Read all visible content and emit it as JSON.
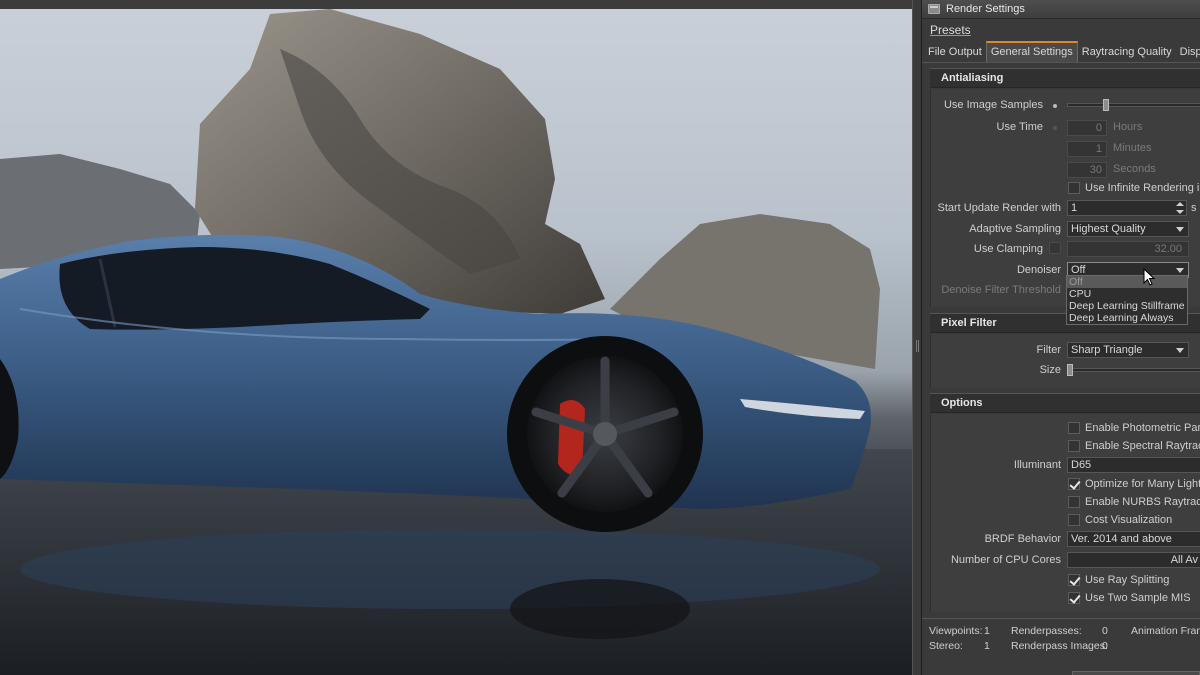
{
  "window": {
    "title": "Render Settings"
  },
  "menu": {
    "presets": "Presets"
  },
  "tabs": [
    "File Output",
    "General Settings",
    "Raytracing Quality",
    "Display Ou"
  ],
  "antialiasing": {
    "header": "Antialiasing",
    "use_image_samples": "Use Image Samples",
    "use_time": "Use Time",
    "hours_value": "0",
    "hours_label": "Hours",
    "minutes_value": "1",
    "minutes_label": "Minutes",
    "seconds_value": "30",
    "seconds_label": "Seconds",
    "infinite_label": "Use Infinite Rendering in V",
    "start_update_label": "Start Update Render with",
    "start_update_value": "1",
    "start_update_suffix": "s",
    "adaptive_label": "Adaptive Sampling",
    "adaptive_value": "Highest Quality",
    "clamping_label": "Use Clamping",
    "clamping_value": "32.00",
    "denoiser_label": "Denoiser",
    "denoiser_value": "Off",
    "denoise_threshold_label": "Denoise Filter Threshold",
    "denoiser_options": [
      "Off",
      "CPU",
      "Deep Learning Stillframe",
      "Deep Learning Always"
    ]
  },
  "pixel_filter": {
    "header": "Pixel Filter",
    "filter_label": "Filter",
    "filter_value": "Sharp Triangle",
    "size_label": "Size"
  },
  "options": {
    "header": "Options",
    "photometric": "Enable Photometric Param",
    "spectral": "Enable Spectral Raytracing",
    "illuminant_label": "Illuminant",
    "illuminant_value": "D65",
    "many_lights": "Optimize for Many Light S",
    "nurbs": "Enable NURBS Raytracing",
    "cost_vis": "Cost Visualization",
    "brdf_label": "BRDF Behavior",
    "brdf_value": "Ver. 2014 and above",
    "cpu_cores_label": "Number of CPU Cores",
    "cpu_cores_value": "All Av",
    "ray_splitting": "Use Ray Splitting",
    "two_sample_mis": "Use Two Sample MIS"
  },
  "status": {
    "viewpoints_label": "Viewpoints:",
    "viewpoints_value": "1",
    "renderpasses_label": "Renderpasses:",
    "renderpasses_value": "0",
    "animation_label": "Animation Fram",
    "stereo_label": "Stereo:",
    "stereo_value": "1",
    "renderpass_images_label": "Renderpass Images:",
    "renderpass_images_value": "0"
  },
  "colors": {
    "accent_tab": "#e08a1e",
    "car_body": "#3d5f88",
    "brake_caliper": "#b3261e",
    "panel_bg": "#3a3a3a"
  }
}
